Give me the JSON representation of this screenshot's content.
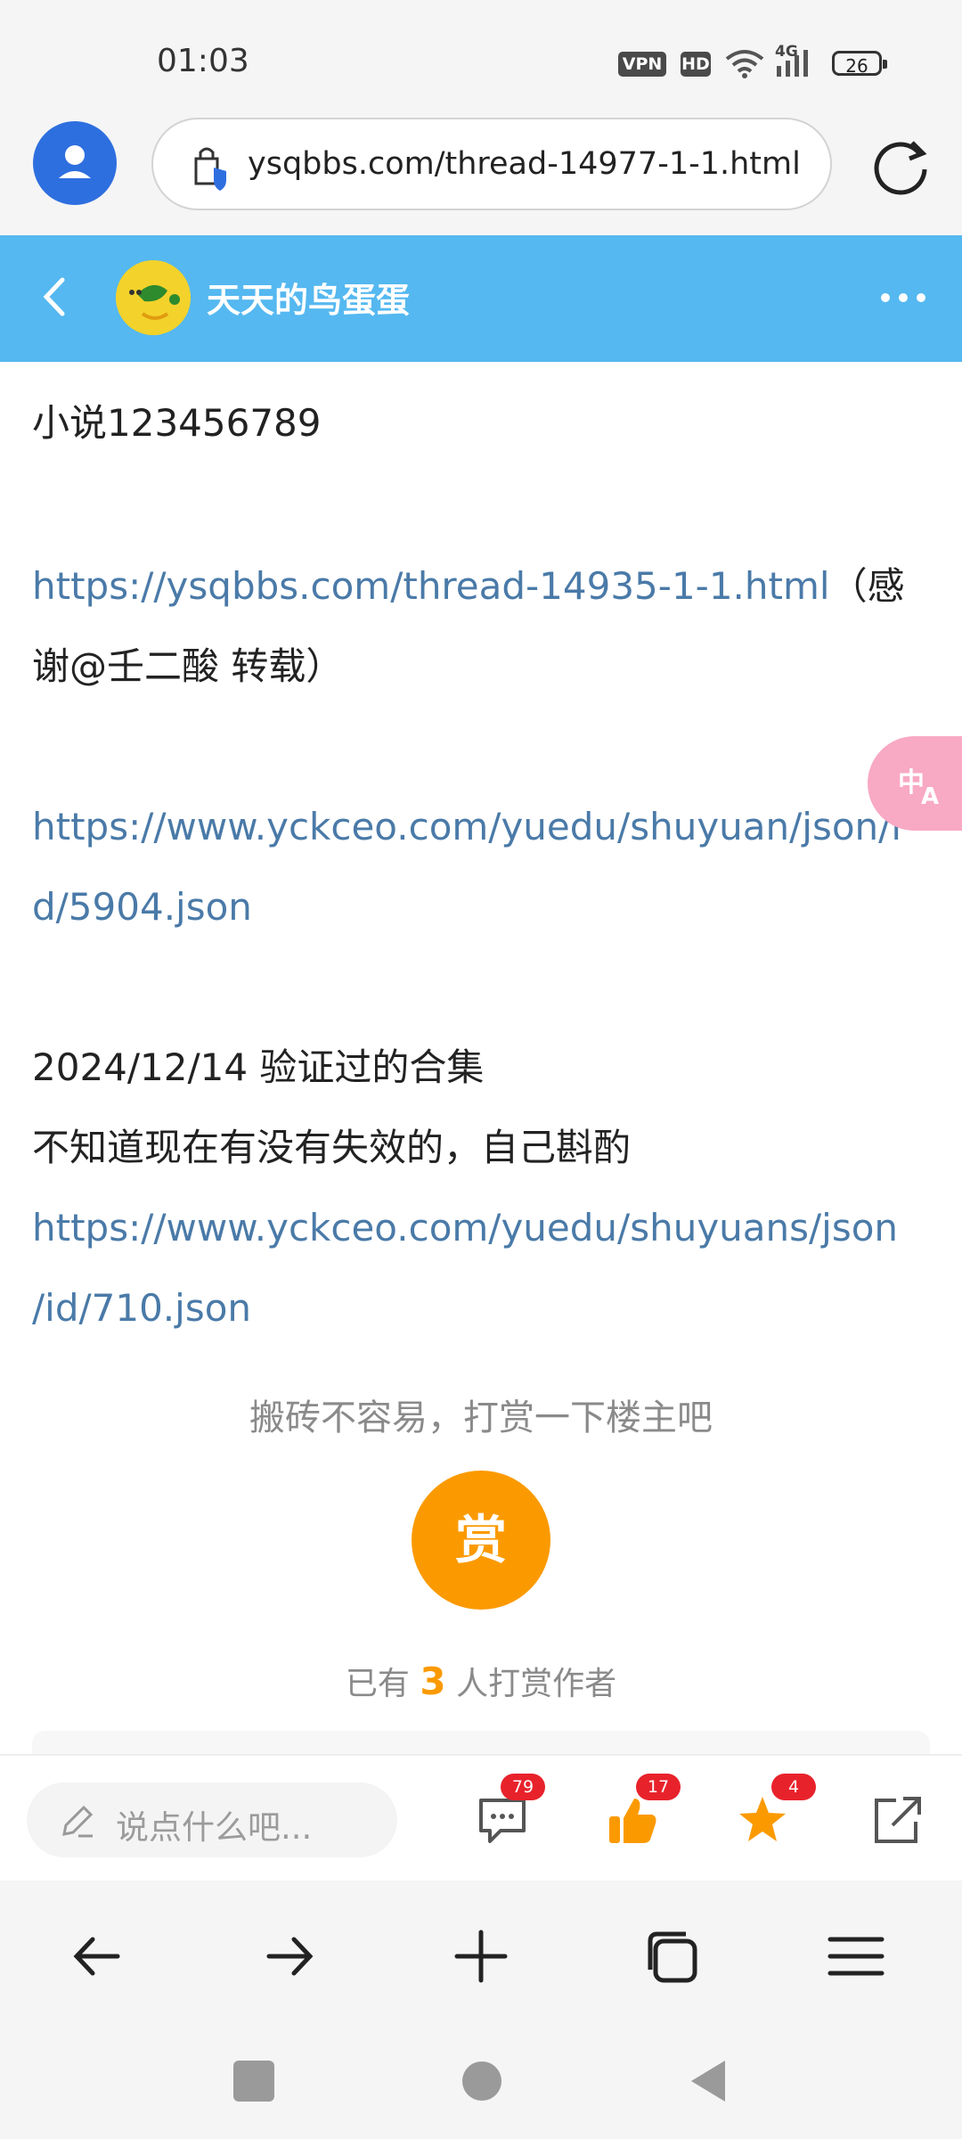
{
  "status_bar": {
    "time": "01:03",
    "vpn_label": "VPN",
    "hd_label": "HD",
    "network_label": "4G",
    "battery": "26"
  },
  "browser": {
    "url": "ysqbbs.com/thread-14977-1-1.html"
  },
  "site": {
    "title": "天天的鸟蛋蛋",
    "header_color": "#55b8f0"
  },
  "post": {
    "line1": "小说123456789",
    "link1": "https://ysqbbs.com/thread-14935-1-1.html",
    "link1_suffix": "（感",
    "line_thanks": "谢@壬二酸 转载）",
    "link2_part1": "https://www.yckceo.com/yuedu/shuyuan/json/i",
    "link2_part2": "d/5904.json",
    "date_line": "2024/12/14 验证过的合集",
    "note_line": "不知道现在有没有失效的，自己斟酌",
    "link3_part1": "https://www.yckceo.com/yuedu/shuyuans/json",
    "link3_part2": "/id/710.json"
  },
  "reward": {
    "hint": "搬砖不容易，打赏一下楼主吧",
    "button_label": "赏",
    "count_prefix": "已有",
    "count": "3",
    "count_suffix": "人打赏作者",
    "accent_color": "#fb9a00"
  },
  "action_bar": {
    "comment_placeholder": "说点什么吧...",
    "comments_count": "79",
    "likes_count": "17",
    "favorites_count": "4"
  },
  "translate_icon": "translate-icon",
  "link_color": "#4a7aa8"
}
